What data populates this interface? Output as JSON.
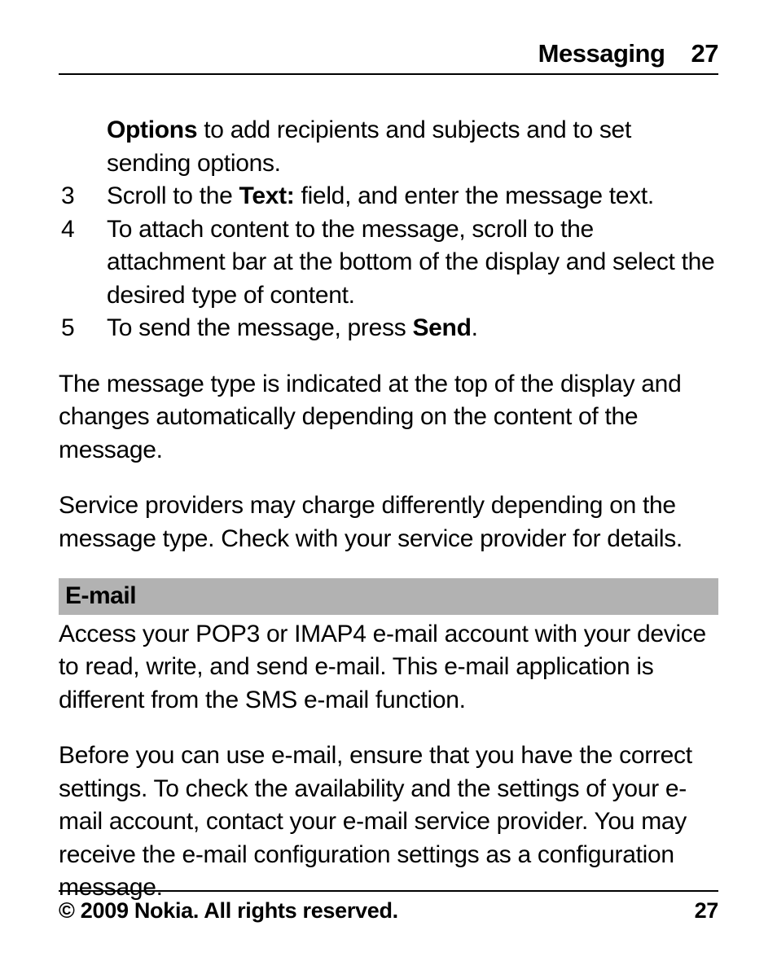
{
  "header": {
    "title": "Messaging",
    "page": "27"
  },
  "body": {
    "cont_options_bold": "Options",
    "cont_options_rest": " to add recipients and subjects and to set sending options.",
    "step3_num": "3",
    "step3_a": "Scroll to the ",
    "step3_bold": "Text:",
    "step3_b": " field, and enter the message text.",
    "step4_num": "4",
    "step4": "To attach content to the message, scroll to the attachment bar at the bottom of the display and select the desired type of content.",
    "step5_num": "5",
    "step5_a": "To send the message, press ",
    "step5_bold": "Send",
    "step5_b": ".",
    "para1": "The message type is indicated at the top of the display and changes automatically depending on the content of the message.",
    "para2": "Service providers may charge differently depending on the message type. Check with your service provider for details.",
    "section_email": "E-mail",
    "email_p1": "Access your POP3 or IMAP4 e-mail account with your device to read, write, and send e-mail. This e-mail application is different from the SMS e-mail function.",
    "email_p2": "Before you can use e-mail, ensure that you have the correct settings. To check the availability and the settings of your e-mail account, contact your e-mail service provider. You may receive the e-mail configuration settings as a configuration message."
  },
  "footer": {
    "copyright": "© 2009 Nokia. All rights reserved.",
    "page": "27"
  }
}
